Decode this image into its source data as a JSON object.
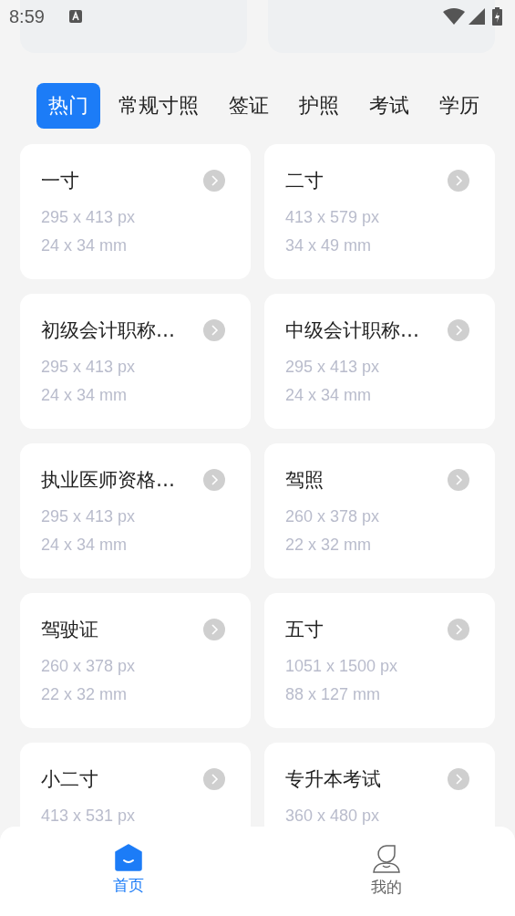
{
  "status_bar": {
    "time": "8:59"
  },
  "tabs": [
    {
      "label": "热门",
      "selected": true
    },
    {
      "label": "常规寸照",
      "selected": false
    },
    {
      "label": "签证",
      "selected": false
    },
    {
      "label": "护照",
      "selected": false
    },
    {
      "label": "考试",
      "selected": false
    },
    {
      "label": "学历",
      "selected": false
    }
  ],
  "cards": [
    {
      "title": "一寸",
      "pixels": "295 x 413 px",
      "size": "24 x 34 mm"
    },
    {
      "title": "二寸",
      "pixels": "413 x 579 px",
      "size": "34 x 49 mm"
    },
    {
      "title": "初级会计职称…",
      "pixels": "295 x 413 px",
      "size": "24 x 34 mm"
    },
    {
      "title": "中级会计职称…",
      "pixels": "295 x 413 px",
      "size": "24 x 34 mm"
    },
    {
      "title": "执业医师资格…",
      "pixels": "295 x 413 px",
      "size": "24 x 34 mm"
    },
    {
      "title": "驾照",
      "pixels": "260 x 378 px",
      "size": "22 x 32 mm"
    },
    {
      "title": "驾驶证",
      "pixels": "260 x 378 px",
      "size": "22 x 32 mm"
    },
    {
      "title": "五寸",
      "pixels": "1051 x 1500 px",
      "size": "88 x 127 mm"
    },
    {
      "title": "小二寸",
      "pixels": "413 x 531 px"
    },
    {
      "title": "专升本考试",
      "pixels": "360 x 480 px"
    }
  ],
  "bottom_nav": [
    {
      "label": "首页",
      "kind": "home",
      "selected": true
    },
    {
      "label": "我的",
      "kind": "profile",
      "selected": false
    }
  ]
}
